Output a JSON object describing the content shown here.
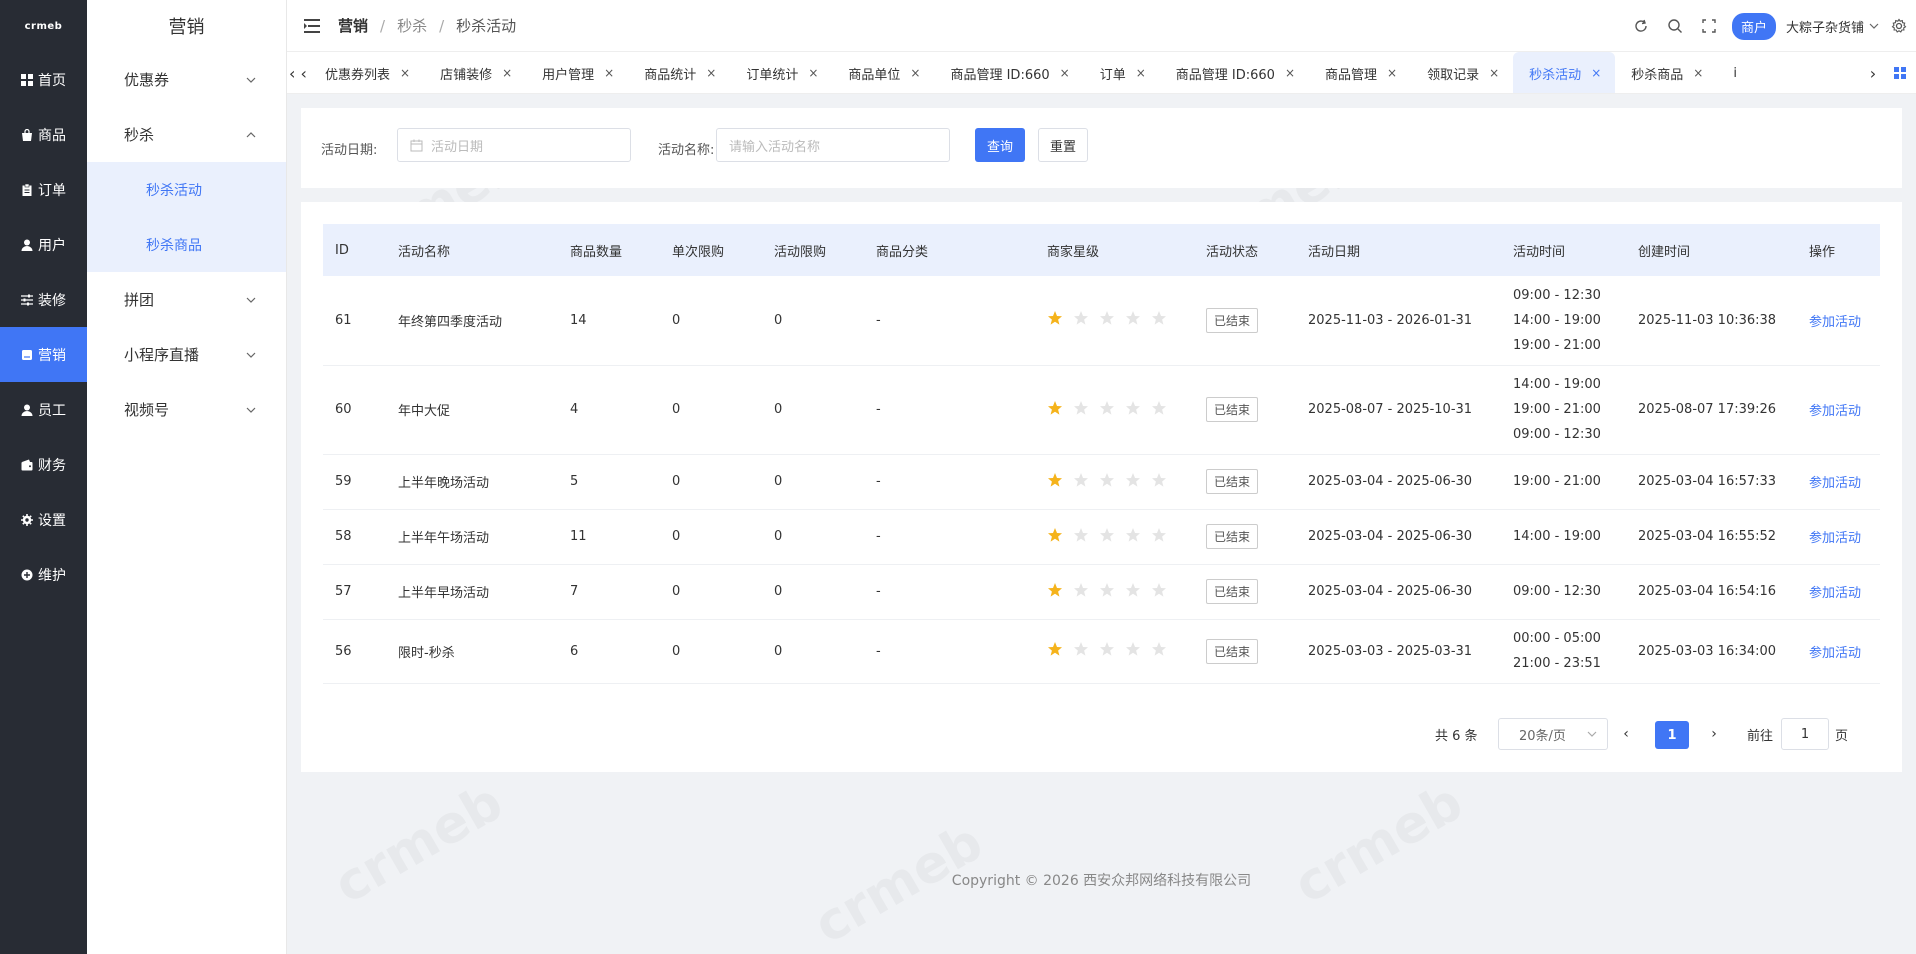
{
  "brand": {
    "logo_text": "crmeb"
  },
  "rail": {
    "items": [
      {
        "label": "首页",
        "icon": "grid-icon"
      },
      {
        "label": "商品",
        "icon": "bag-icon"
      },
      {
        "label": "订单",
        "icon": "clipboard-icon"
      },
      {
        "label": "用户",
        "icon": "user-icon"
      },
      {
        "label": "装修",
        "icon": "sliders-icon"
      },
      {
        "label": "营销",
        "icon": "marketing-icon",
        "active": true
      },
      {
        "label": "员工",
        "icon": "staff-icon"
      },
      {
        "label": "财务",
        "icon": "wallet-icon"
      },
      {
        "label": "设置",
        "icon": "gear-icon"
      },
      {
        "label": "维护",
        "icon": "maintenance-icon"
      }
    ]
  },
  "submenu": {
    "title": "营销",
    "items": [
      {
        "label": "优惠券"
      },
      {
        "label": "秒杀"
      },
      {
        "label": "秒杀活动"
      },
      {
        "label": "秒杀商品"
      },
      {
        "label": "拼团"
      },
      {
        "label": "小程序直播"
      },
      {
        "label": "视频号"
      }
    ]
  },
  "header": {
    "breadcrumb": [
      "营销",
      "秒杀",
      "秒杀活动"
    ],
    "separator": "/",
    "merchant_badge": "商户",
    "shop_name": "大粽子杂货铺"
  },
  "tabs": {
    "items": [
      "优惠券列表",
      "店铺装修",
      "用户管理",
      "商品统计",
      "订单统计",
      "商品单位",
      "商品管理 ID:660",
      "订单",
      "商品管理 ID:660",
      "商品管理",
      "领取记录",
      "秒杀活动",
      "秒杀商品",
      "i"
    ],
    "active_index": 11,
    "close_glyph": "×"
  },
  "filters": {
    "date_label": "活动日期:",
    "date_placeholder": "活动日期",
    "name_label": "活动名称:",
    "name_placeholder": "请输入活动名称",
    "query_button": "查询",
    "reset_button": "重置"
  },
  "table": {
    "columns": [
      "ID",
      "活动名称",
      "商品数量",
      "单次限购",
      "活动限购",
      "商品分类",
      "商家星级",
      "活动状态",
      "活动日期",
      "活动时间",
      "创建时间",
      "操作"
    ],
    "rows": [
      {
        "id": "61",
        "name": "年终第四季度活动",
        "qty": "14",
        "single": "0",
        "total": "0",
        "category": "-",
        "stars": 1,
        "status": "已结束",
        "date": "2025-11-03 - 2026-01-31",
        "times": [
          "09:00 - 12:30",
          "14:00 - 19:00",
          "19:00 - 21:00"
        ],
        "created": "2025-11-03 10:36:38",
        "action": "参加活动"
      },
      {
        "id": "60",
        "name": "年中大促",
        "qty": "4",
        "single": "0",
        "total": "0",
        "category": "-",
        "stars": 1,
        "status": "已结束",
        "date": "2025-08-07 - 2025-10-31",
        "times": [
          "14:00 - 19:00",
          "19:00 - 21:00",
          "09:00 - 12:30"
        ],
        "created": "2025-08-07 17:39:26",
        "action": "参加活动"
      },
      {
        "id": "59",
        "name": "上半年晚场活动",
        "qty": "5",
        "single": "0",
        "total": "0",
        "category": "-",
        "stars": 1,
        "status": "已结束",
        "date": "2025-03-04 - 2025-06-30",
        "times": [
          "19:00 - 21:00"
        ],
        "created": "2025-03-04 16:57:33",
        "action": "参加活动"
      },
      {
        "id": "58",
        "name": "上半年午场活动",
        "qty": "11",
        "single": "0",
        "total": "0",
        "category": "-",
        "stars": 1,
        "status": "已结束",
        "date": "2025-03-04 - 2025-06-30",
        "times": [
          "14:00 - 19:00"
        ],
        "created": "2025-03-04 16:55:52",
        "action": "参加活动"
      },
      {
        "id": "57",
        "name": "上半年早场活动",
        "qty": "7",
        "single": "0",
        "total": "0",
        "category": "-",
        "stars": 1,
        "status": "已结束",
        "date": "2025-03-04 - 2025-06-30",
        "times": [
          "09:00 - 12:30"
        ],
        "created": "2025-03-04 16:54:16",
        "action": "参加活动"
      },
      {
        "id": "56",
        "name": "限时-秒杀",
        "qty": "6",
        "single": "0",
        "total": "0",
        "category": "-",
        "stars": 1,
        "status": "已结束",
        "date": "2025-03-03 - 2025-03-31",
        "times": [
          "00:00 - 05:00",
          "21:00 - 23:51"
        ],
        "created": "2025-03-03 16:34:00",
        "action": "参加活动"
      }
    ],
    "max_stars": 5
  },
  "pagination": {
    "total_text": "共 6 条",
    "page_size": "20条/页",
    "current_page": "1",
    "goto_label": "前往",
    "goto_value": "1",
    "page_suffix": "页"
  },
  "footer": {
    "copyright": "Copyright © 2026 西安众邦网络科技有限公司"
  },
  "colors": {
    "primary": "#4076f5",
    "rail_bg": "#282c34",
    "star_on": "#f5b31b",
    "star_off": "#e4e4e4"
  }
}
